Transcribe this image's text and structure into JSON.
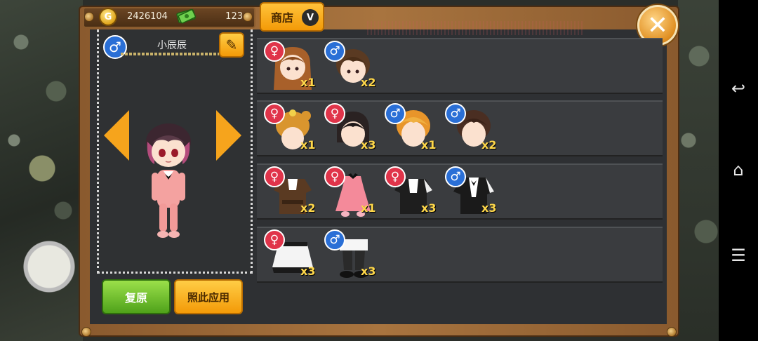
{
  "header": {
    "gold_badge": "G",
    "gold_amount": "2426104",
    "cash_amount": "123",
    "shop_label": "商店",
    "shop_badge": "V"
  },
  "character": {
    "name": "小辰辰",
    "gender_symbol": "♂"
  },
  "buttons": {
    "restore": "复原",
    "apply": "照此应用",
    "close": "✕"
  },
  "rows": [
    {
      "category": "hair-style",
      "items": [
        {
          "gender": "♀",
          "qty": "x1",
          "kind": "hair-long"
        },
        {
          "gender": "♂",
          "qty": "x2",
          "kind": "hair-short"
        }
      ]
    },
    {
      "category": "hats",
      "items": [
        {
          "gender": "♀",
          "qty": "x1",
          "kind": "hat-bear"
        },
        {
          "gender": "♀",
          "qty": "x3",
          "kind": "hair-bob"
        },
        {
          "gender": "♂",
          "qty": "x1",
          "kind": "hair-blonde"
        },
        {
          "gender": "♂",
          "qty": "x2",
          "kind": "hair-brown"
        }
      ]
    },
    {
      "category": "tops",
      "items": [
        {
          "gender": "♀",
          "qty": "x2",
          "kind": "top-brown"
        },
        {
          "gender": "♀",
          "qty": "x1",
          "kind": "dress-pink"
        },
        {
          "gender": "♀",
          "qty": "x3",
          "kind": "top-black"
        },
        {
          "gender": "♂",
          "qty": "x3",
          "kind": "suit-black"
        }
      ]
    },
    {
      "category": "bottoms",
      "items": [
        {
          "gender": "♀",
          "qty": "x3",
          "kind": "skirt-maid"
        },
        {
          "gender": "♂",
          "qty": "x3",
          "kind": "pants-shoes"
        }
      ]
    }
  ],
  "navigation": {
    "back": "↩",
    "home": "⌂",
    "menu": "☰"
  },
  "colors": {
    "female": "#e0344a",
    "male": "#2a6fd6",
    "accent": "#f39a08",
    "qty": "#ffd84a"
  }
}
